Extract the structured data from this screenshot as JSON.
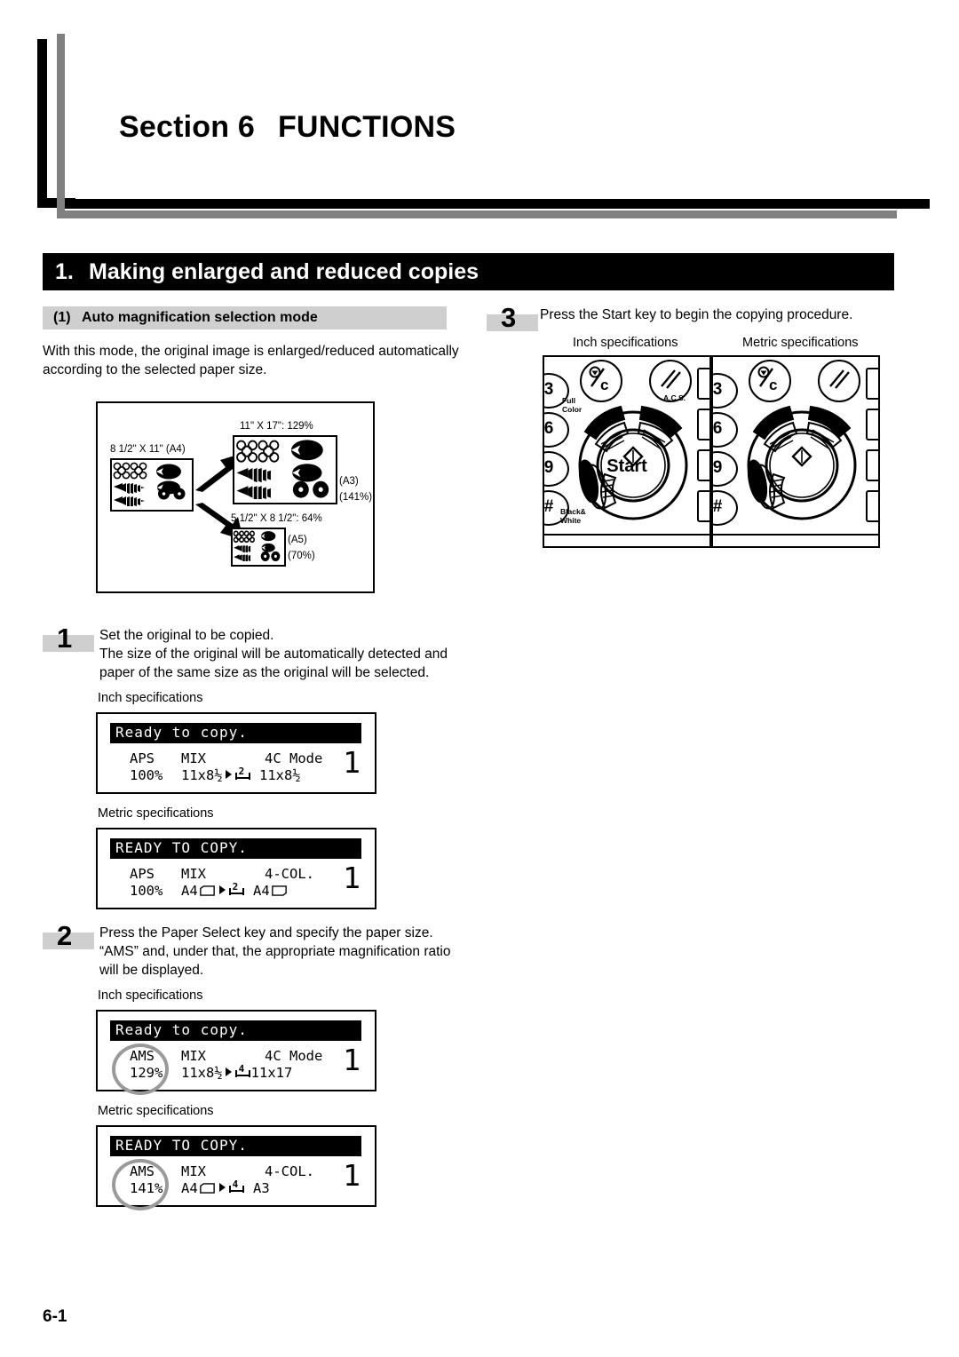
{
  "section": {
    "label": "Section 6",
    "title": "FUNCTIONS"
  },
  "chapter": {
    "number": "1.",
    "title": "Making enlarged and reduced copies"
  },
  "subsection": {
    "number": "(1)",
    "title": "Auto magnification selection mode"
  },
  "intro": {
    "line1": "With this mode, the original image is enlarged/reduced automatically",
    "line2": "according to the selected paper size."
  },
  "illustration": {
    "original_label": "8 1/2\" X 11\" (A4)",
    "enlarge_label": "11\" X 17\": 129%",
    "enlarge_metric_1": "(A3)",
    "enlarge_metric_2": "(141%)",
    "reduce_label": "5 1/2\" X 8 1/2\": 64%",
    "reduce_metric_1": "(A5)",
    "reduce_metric_2": "(70%)"
  },
  "steps": [
    {
      "number": "1",
      "lines": [
        "Set the original to be copied.",
        "The size of the original will be automatically detected and",
        "paper of the same size as the original will be selected."
      ]
    },
    {
      "number": "2",
      "lines": [
        "Press the Paper Select key and specify the paper size.",
        "“AMS” and, under that, the appropriate magnification ratio",
        "will be displayed."
      ]
    },
    {
      "number": "3",
      "lines": [
        "Press the Start key to begin the copying procedure."
      ]
    }
  ],
  "captions": {
    "inch": "Inch specifications",
    "metric": "Metric specifications"
  },
  "displays": {
    "step1_inch": {
      "status": "Ready to copy.",
      "mode": "APS",
      "mix": "MIX",
      "color": "4C Mode",
      "ratio": "100%",
      "src": "11x8½",
      "dst": "11x8½",
      "duplex": "2",
      "count": "1"
    },
    "step1_metric": {
      "status": "READY TO COPY.",
      "mode": "APS",
      "mix": "MIX",
      "color": "4-COL.",
      "ratio": "100%",
      "src": "A4",
      "dst": "A4",
      "duplex": "2",
      "count": "1"
    },
    "step2_inch": {
      "status": "Ready to copy.",
      "mode": "AMS",
      "mix": "MIX",
      "color": "4C Mode",
      "ratio": "129%",
      "src": "11x8½",
      "dst": "11x17",
      "duplex": "4",
      "count": "1"
    },
    "step2_metric": {
      "status": "READY TO COPY.",
      "mode": "AMS",
      "mix": "MIX",
      "color": "4-COL.",
      "ratio": "141%",
      "src": "A4",
      "dst": "A3",
      "duplex": "4",
      "count": "1"
    }
  },
  "control_panel": {
    "start_label": "Start",
    "full_color_label_1": "Full",
    "full_color_label_2": "Color",
    "black_white_label_1": "Black&",
    "black_white_label_2": "White",
    "acs_label": "A.C.S.",
    "key_3": "3",
    "key_6": "6",
    "key_9": "9",
    "key_hash": "#",
    "interrupt_icon": "%c"
  },
  "footer": {
    "page_number": "6-1"
  },
  "colors": {
    "ink": "#000000",
    "gray_chip": "#cfcfcf",
    "gray_rule": "#808080",
    "highlight_ring": "#9a9a9a"
  }
}
